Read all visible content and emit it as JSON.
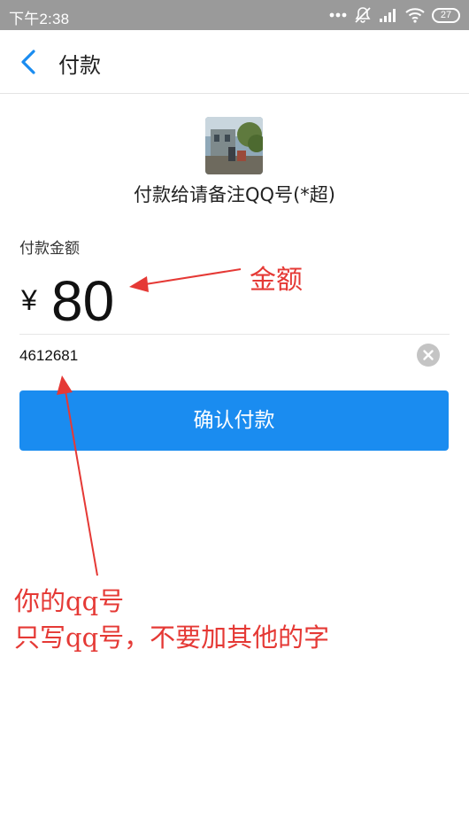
{
  "status_bar": {
    "time": "下午2:38",
    "battery": "27",
    "icons": [
      "more-dots-icon",
      "mute-icon",
      "signal-icon",
      "wifi-icon",
      "battery-icon"
    ]
  },
  "header": {
    "title": "付款",
    "back_icon": "chevron-left-icon"
  },
  "merchant": {
    "name": "付款给请备注QQ号(*超)",
    "avatar": "merchant-avatar-photo"
  },
  "payment": {
    "amount_label": "付款金额",
    "currency": "¥",
    "amount": "80",
    "note_value": "4612681",
    "clear_icon": "clear-icon"
  },
  "actions": {
    "confirm_label": "确认付款"
  },
  "annotations": {
    "amount_note": "金额",
    "qq_note_line1": "你的qq号",
    "qq_note_line2": "只写qq号，不要加其他的字",
    "color": "#e53935"
  },
  "colors": {
    "accent": "#1a8cf0",
    "status_bar": "#9a9a9a"
  }
}
